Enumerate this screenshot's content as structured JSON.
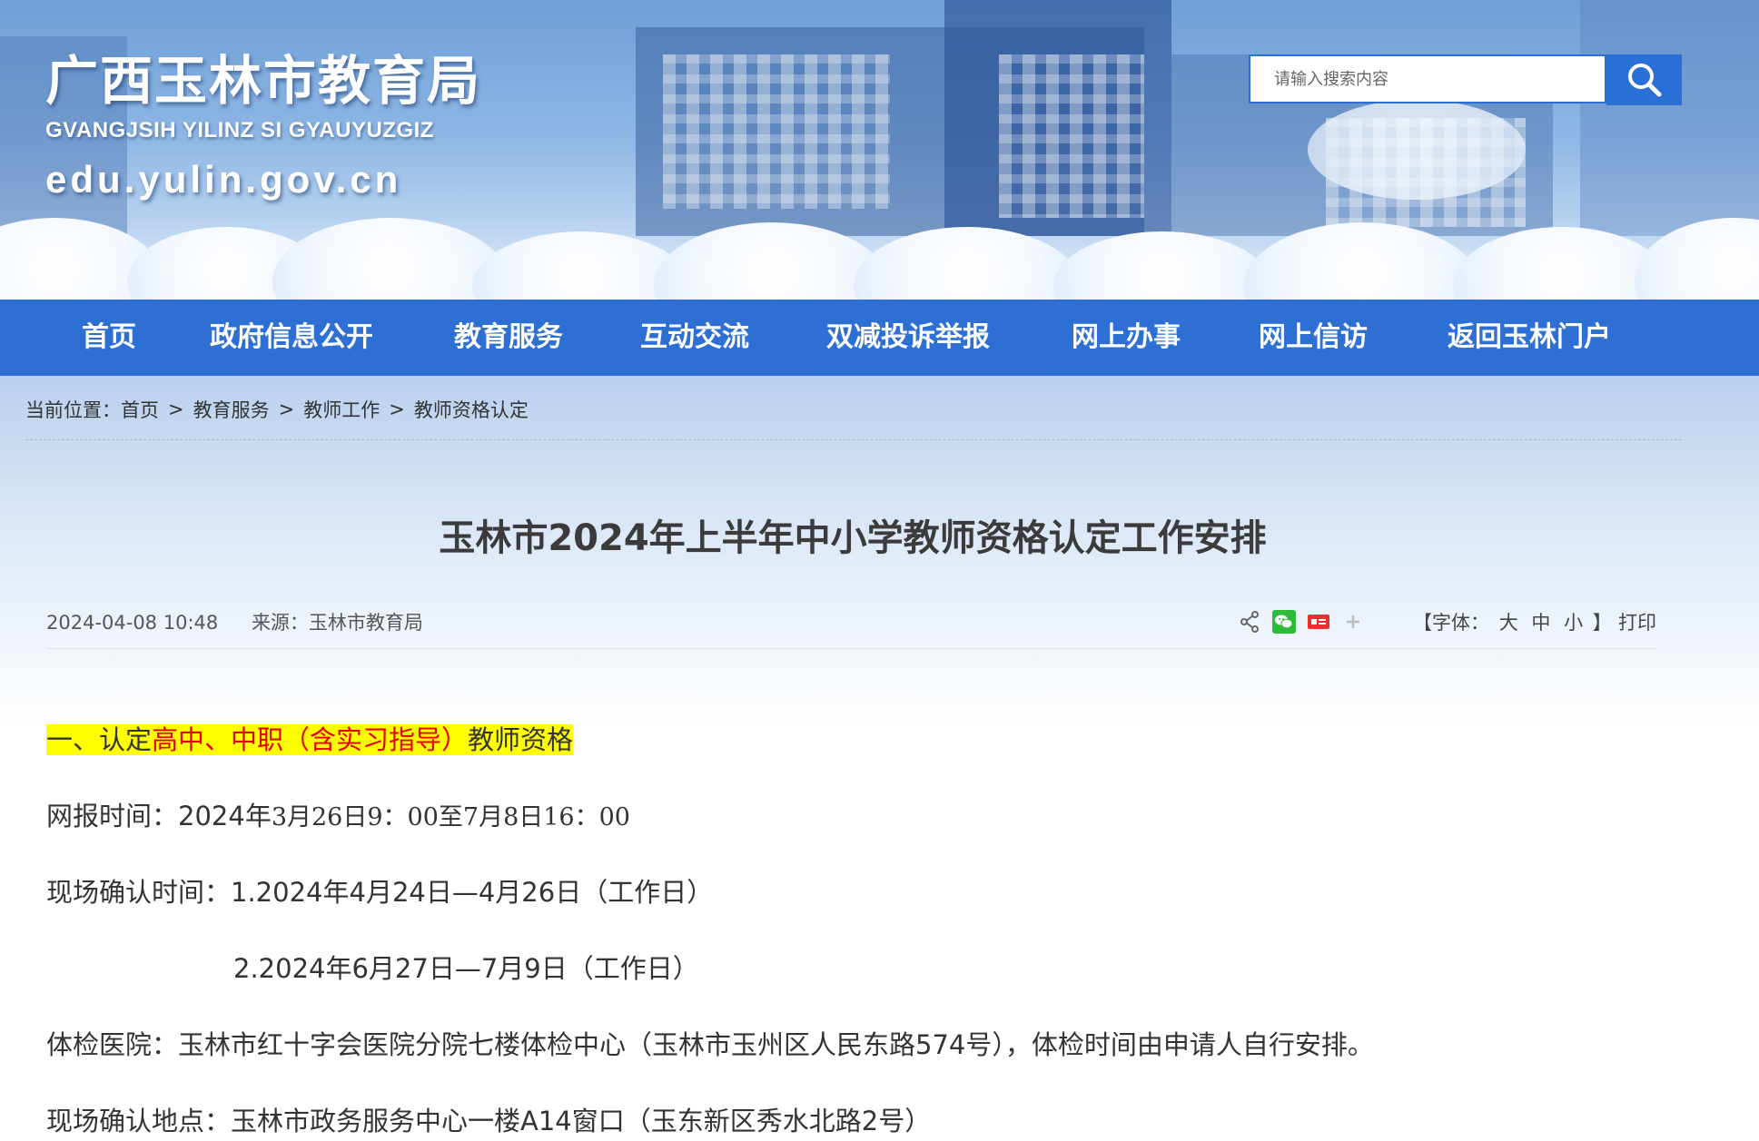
{
  "header": {
    "site_name_cn": "广西玉林市教育局",
    "site_name_zhuang": "GVANGJSIH YILINZ SI GYAUYUZGIZ",
    "domain": "edu.yulin.gov.cn",
    "search_placeholder": "请输入搜索内容"
  },
  "nav": {
    "items": [
      "首页",
      "政府信息公开",
      "教育服务",
      "互动交流",
      "双减投诉举报",
      "网上办事",
      "网上信访",
      "返回玉林门户"
    ]
  },
  "breadcrumb": {
    "prefix": "当前位置：",
    "items": [
      "首页",
      "教育服务",
      "教师工作",
      "教师资格认定"
    ],
    "separator": ">"
  },
  "article": {
    "title": "玉林市2024年上半年中小学教师资格认定工作安排",
    "date": "2024-04-08 10:48",
    "source": "来源：玉林市教育局",
    "font_label": "【字体：",
    "font_large": "大",
    "font_medium": "中",
    "font_small": "小",
    "font_end": "】",
    "print": "打印",
    "section1_prefix": "一、认定",
    "section1_red": "高中、中职（含实习指导）",
    "section1_suffix": "教师资格",
    "online_label": "网报时间：",
    "online_year": "2024年",
    "online_rest": "3月26日9：00至7月8日16：00",
    "confirm_time_label": "现场确认时间：",
    "confirm_time_1": "1.2024年4月24日—4月26日（工作日）",
    "confirm_time_2": "2.2024年6月27日—7月9日（工作日）",
    "hospital": "体检医院：玉林市红十字会医院分院七楼体检中心（玉林市玉州区人民东路574号），体检时间由申请人自行安排。",
    "confirm_place": "现场确认地点：玉林市政务服务中心一楼A14窗口（玉东新区秀水北路2号）"
  },
  "share_icons": [
    "share-icon",
    "wechat-icon",
    "toutiao-icon",
    "plus-icon"
  ],
  "colors": {
    "nav_bg": "#2e6fd4",
    "search_btn": "#2a6fd6",
    "highlight": "#ffff00",
    "red_text": "#e60000",
    "title_text": "#3b3b3b"
  }
}
